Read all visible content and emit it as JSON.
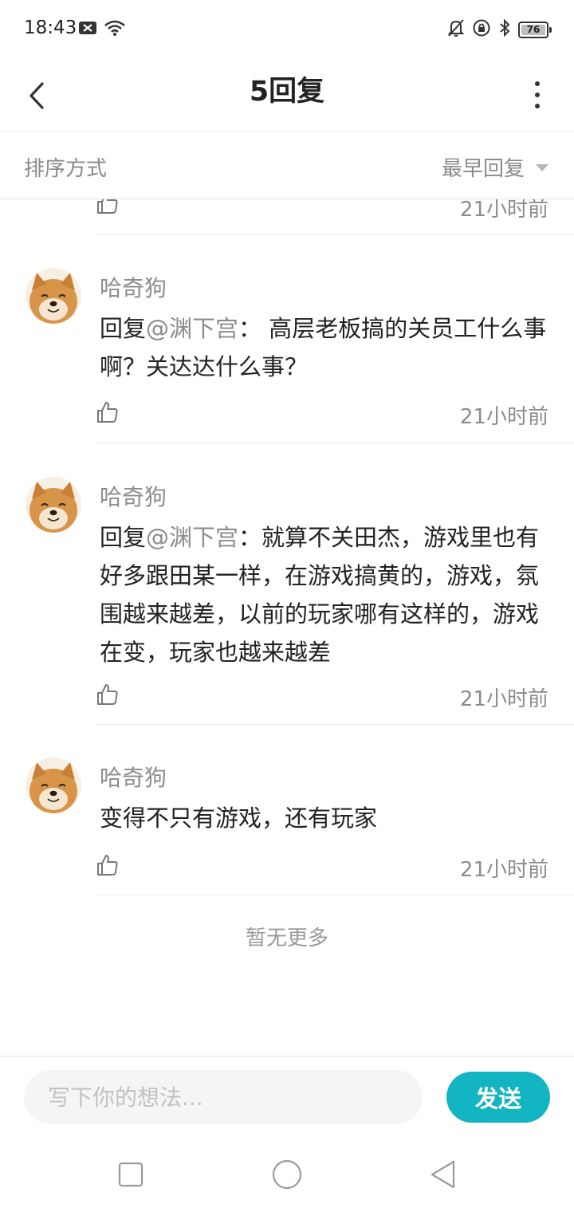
{
  "status": {
    "time": "18:43",
    "battery": "76"
  },
  "header": {
    "title": "5回复"
  },
  "sort": {
    "label": "排序方式",
    "value": "最早回复"
  },
  "partial_item": {
    "time": "21小时前"
  },
  "comments": [
    {
      "name": "哈奇狗",
      "prefix": "回复",
      "mention": "@渊下宫",
      "text": "： 高层老板搞的关员工什么事啊？关达达什么事？",
      "time": "21小时前"
    },
    {
      "name": "哈奇狗",
      "prefix": "回复",
      "mention": "@渊下宫",
      "text": "：就算不关田杰，游戏里也有好多跟田某一样，在游戏搞黄的，游戏，氛围越来越差，以前的玩家哪有这样的，游戏在变，玩家也越来越差",
      "time": "21小时前"
    },
    {
      "name": "哈奇狗",
      "prefix": "",
      "mention": "",
      "text": "变得不只有游戏，还有玩家",
      "time": "21小时前"
    }
  ],
  "footer": {
    "no_more": "暂无更多"
  },
  "input": {
    "placeholder": "写下你的想法...",
    "send_label": "发送"
  },
  "colors": {
    "accent": "#14b5c2",
    "muted": "#8c8c8c"
  }
}
